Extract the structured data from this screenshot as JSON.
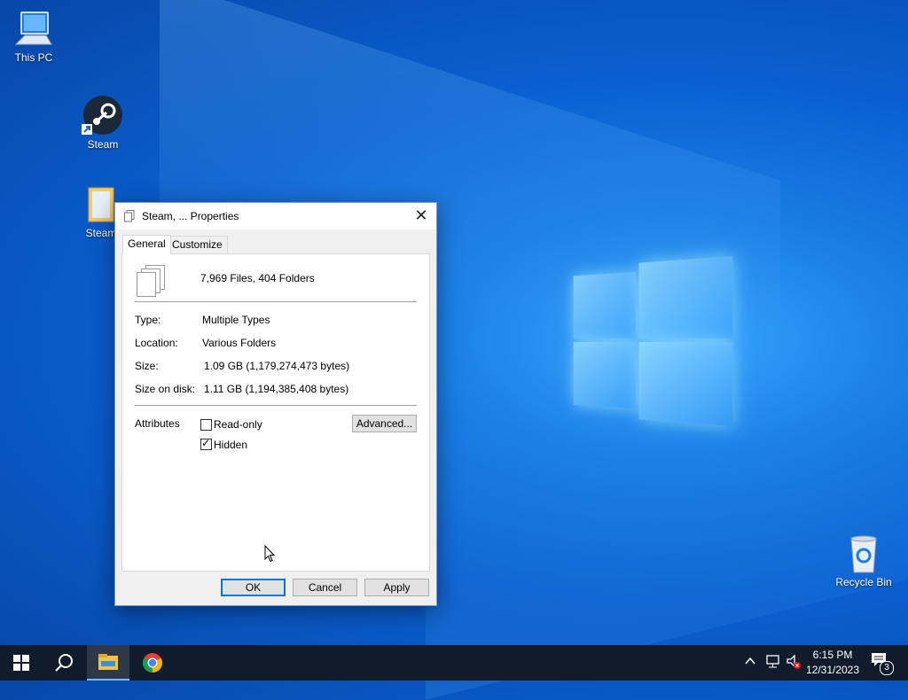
{
  "desktop": {
    "icons": [
      {
        "label": "This PC"
      },
      {
        "label": "Steam"
      },
      {
        "label": "Steam"
      },
      {
        "label": "Recycle Bin"
      }
    ]
  },
  "dialog": {
    "title": "Steam, ... Properties",
    "tabs": [
      {
        "label": "General"
      },
      {
        "label": "Customize"
      }
    ],
    "summary": "7,969 Files, 404 Folders",
    "rows": [
      {
        "label": "Type:",
        "value": "Multiple Types"
      },
      {
        "label": "Location:",
        "value": "Various Folders"
      },
      {
        "label": "Size:",
        "value": "1.09 GB (1,179,274,473 bytes)"
      },
      {
        "label": "Size on disk:",
        "value": "1.11 GB (1,194,385,408 bytes)"
      }
    ],
    "attributes_label": "Attributes",
    "readonly": {
      "label": "Read-only",
      "checked": false
    },
    "hidden": {
      "label": "Hidden",
      "checked": true
    },
    "advanced_label": "Advanced...",
    "ok_label": "OK",
    "cancel_label": "Cancel",
    "apply_label": "Apply"
  },
  "taskbar": {
    "time": "6:15 PM",
    "date": "12/31/2023",
    "notification_count": "3",
    "icons": [
      "windows-start-icon",
      "search-icon",
      "file-explorer-icon",
      "chrome-icon"
    ]
  },
  "colors": {
    "accent": "#0078d7",
    "taskbar": "#101c2c"
  }
}
